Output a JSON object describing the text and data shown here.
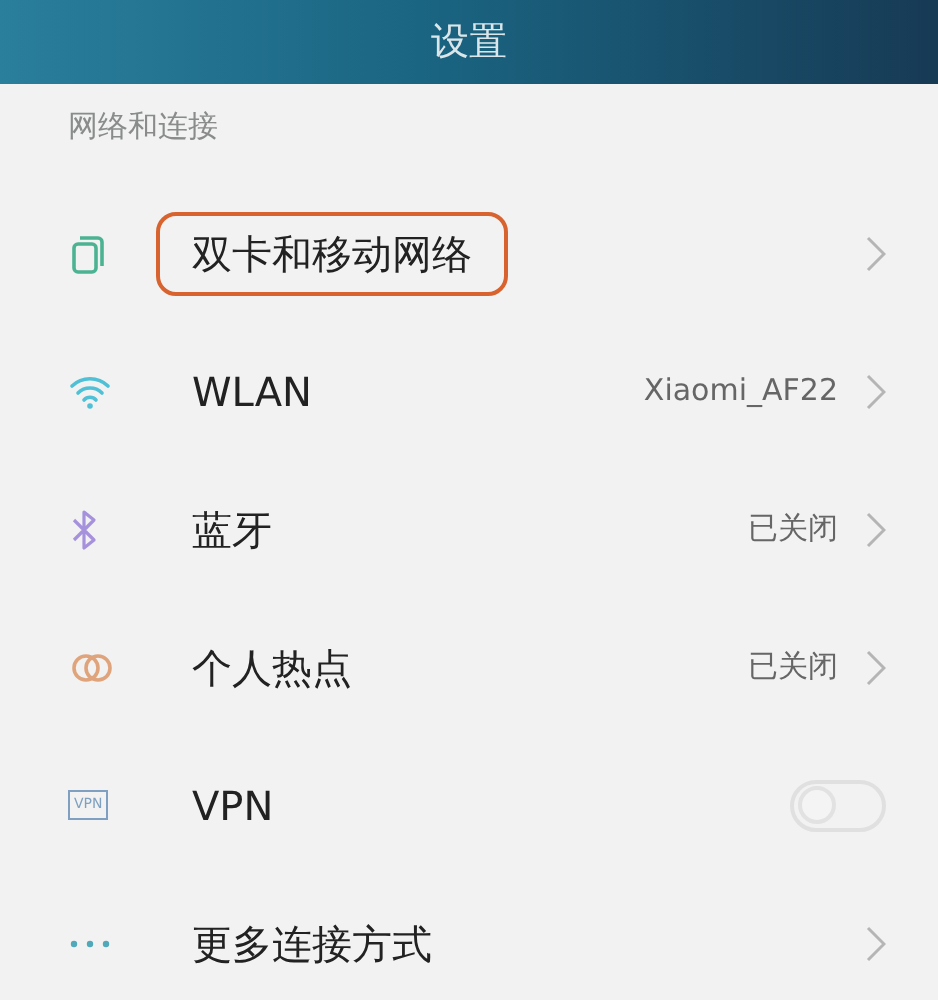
{
  "title": "设置",
  "section": "网络和连接",
  "items": [
    {
      "kind": "link",
      "label": "双卡和移动网络",
      "highlighted": true
    },
    {
      "kind": "link",
      "label": "WLAN",
      "value": "Xiaomi_AF22",
      "highlighted": false
    },
    {
      "kind": "link",
      "label": "蓝牙",
      "value": "已关闭",
      "highlighted": false
    },
    {
      "kind": "link",
      "label": "个人热点",
      "value": "已关闭",
      "highlighted": false
    },
    {
      "kind": "toggle",
      "icon_text": "VPN",
      "label": "VPN",
      "on": false,
      "highlighted": false
    },
    {
      "kind": "link",
      "label": "更多连接方式",
      "highlighted": false
    }
  ]
}
